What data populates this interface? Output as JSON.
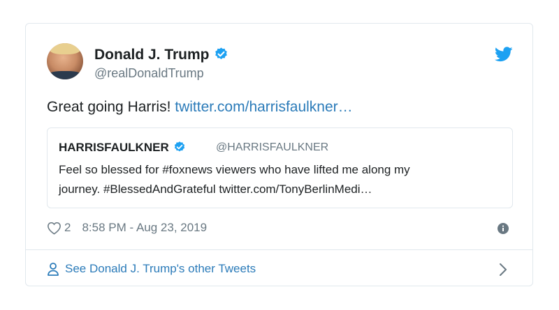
{
  "author": {
    "name": "Donald J. Trump",
    "handle": "@realDonaldTrump"
  },
  "tweet": {
    "text": "Great going Harris!",
    "link": "twitter.com/harrisfaulkner…"
  },
  "quoted": {
    "name": "HARRISFAULKNER",
    "handle": "@HARRISFAULKNER",
    "line1": "Feel so blessed for #foxnews viewers who have lifted me along my",
    "line2": "journey.  #BlessedAndGrateful twitter.com/TonyBerlinMedi…"
  },
  "meta": {
    "likes": "2",
    "timestamp": "8:58 PM - Aug 23, 2019"
  },
  "footer": {
    "link": "See Donald J. Trump's other Tweets"
  },
  "colors": {
    "accent": "#1da1f2",
    "link": "#2b7bb9",
    "muted": "#697882",
    "border": "#e1e8ed"
  },
  "icons": [
    "verified-icon",
    "twitter-bird-icon",
    "heart-icon",
    "info-icon",
    "person-icon",
    "chevron-right-icon"
  ]
}
